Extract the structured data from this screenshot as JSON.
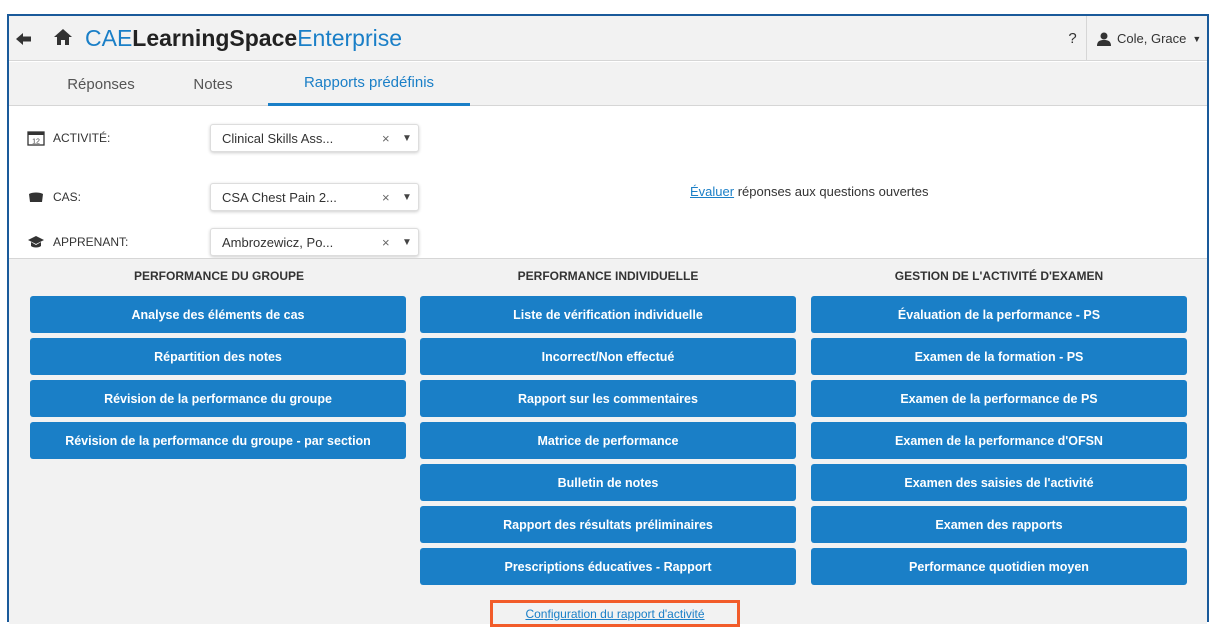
{
  "header": {
    "logo_part1": "CAE",
    "logo_part2": "LearningSpace",
    "logo_part3": "Enterprise",
    "help_label": "?",
    "user_name": "Cole, Grace"
  },
  "tabs": [
    {
      "label": "Réponses",
      "active": false
    },
    {
      "label": "Notes",
      "active": false
    },
    {
      "label": "Rapports prédéfinis",
      "active": true
    }
  ],
  "filters": {
    "activity": {
      "label": "ACTIVITÉ:",
      "value": "Clinical Skills Ass...",
      "icon": "calendar-icon"
    },
    "case": {
      "label": "CAS:",
      "value": "CSA Chest Pain 2...",
      "icon": "hat-icon"
    },
    "learner": {
      "label": "APPRENANT:",
      "value": "Ambrozewicz, Po...",
      "icon": "graduation-cap-icon"
    },
    "evaluate_link": "Évaluer",
    "evaluate_text": " réponses aux questions ouvertes"
  },
  "reports": {
    "group": {
      "title": "PERFORMANCE DU GROUPE",
      "buttons": [
        "Analyse des éléments de cas",
        "Répartition des notes",
        "Révision de la performance du groupe",
        "Révision de la performance du groupe - par section"
      ]
    },
    "individual": {
      "title": "PERFORMANCE INDIVIDUELLE",
      "buttons": [
        "Liste de vérification individuelle",
        "Incorrect/Non effectué",
        "Rapport sur les commentaires",
        "Matrice de performance",
        "Bulletin de notes",
        "Rapport des résultats préliminaires",
        "Prescriptions éducatives - Rapport"
      ]
    },
    "exam": {
      "title": "GESTION DE L'ACTIVITÉ D'EXAMEN",
      "buttons": [
        "Évaluation de la performance - PS",
        "Examen de la formation - PS",
        "Examen de la performance de PS",
        "Examen de la performance d'OFSN",
        "Examen des saisies de l'activité",
        "Examen des rapports",
        "Performance quotidien moyen"
      ]
    },
    "config_link": "Configuration du rapport d'activité"
  },
  "colors": {
    "accent": "#1a7fc7",
    "highlight": "#f25c2a",
    "panel": "#f2f2f2"
  }
}
